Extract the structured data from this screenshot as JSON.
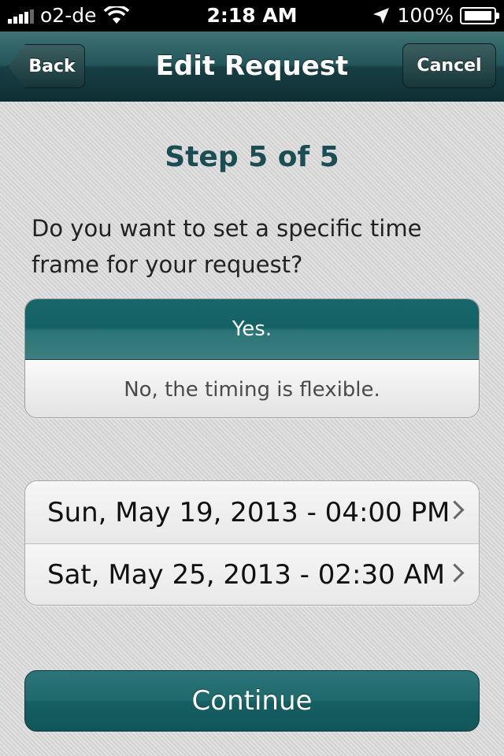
{
  "status_bar": {
    "carrier": "o2-de",
    "time": "2:18 AM",
    "battery": "100%",
    "signal_bars": 4,
    "icons": [
      "signal-icon",
      "wifi-icon",
      "location-arrow-icon",
      "battery-charging-icon"
    ]
  },
  "nav": {
    "back_label": "Back",
    "title": "Edit Request",
    "cancel_label": "Cancel"
  },
  "step_label": "Step 5 of 5",
  "question": "Do you want to set a specific time frame for your request?",
  "options": {
    "yes": "Yes.",
    "no": "No, the timing is flexible.",
    "selected": "yes"
  },
  "dates": [
    {
      "label": "Sun, May 19, 2013 - 04:00 PM"
    },
    {
      "label": "Sat, May 25, 2013 - 02:30 AM"
    }
  ],
  "continue_label": "Continue",
  "colors": {
    "accent": "#17666a",
    "nav_dark": "#173f44",
    "title_text": "#1c4d52"
  }
}
